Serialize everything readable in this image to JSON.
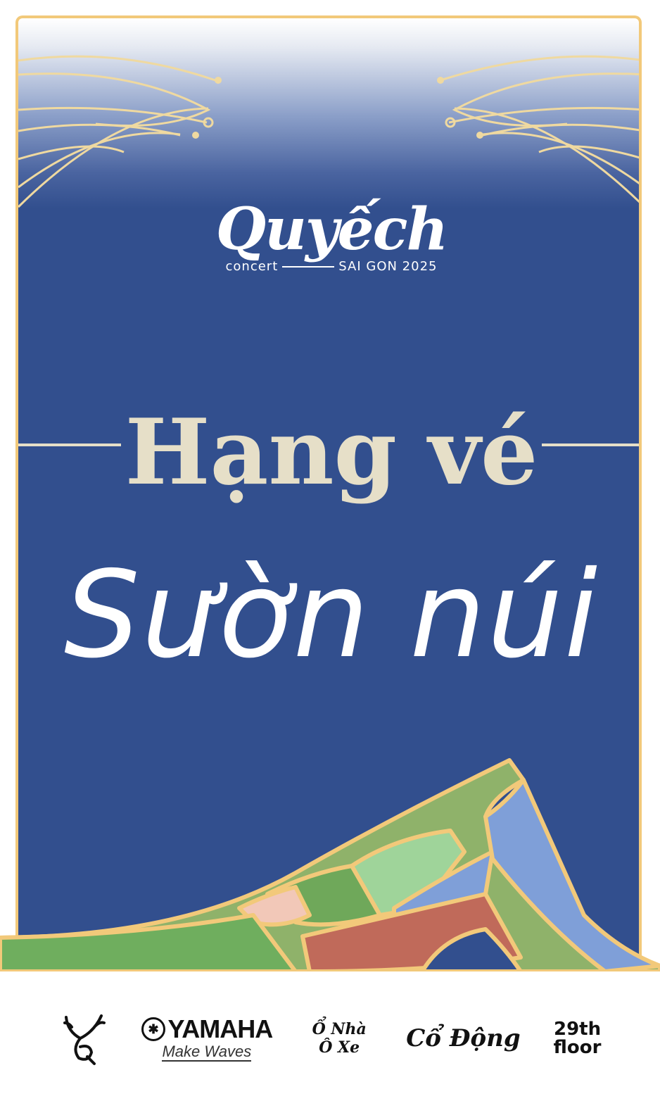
{
  "colors": {
    "navy": "#324f8e",
    "gold": "#f2c97a",
    "cream": "#e6dfc8",
    "white": "#ffffff"
  },
  "logo": {
    "name": "Quyếch",
    "sub_left": "concert",
    "sub_right": "SAI GON 2025"
  },
  "ticket": {
    "heading": "Hạng vé",
    "tier": "Sườn núi"
  },
  "sponsors": [
    {
      "icon": "deer-antler-logo-icon"
    },
    {
      "name": "YAMAHA",
      "tagline": "Make Waves"
    },
    {
      "name": "Ổ Nhà Ô Xe"
    },
    {
      "name": "Cổ Động"
    },
    {
      "name": "29th",
      "sub": "floor"
    }
  ]
}
